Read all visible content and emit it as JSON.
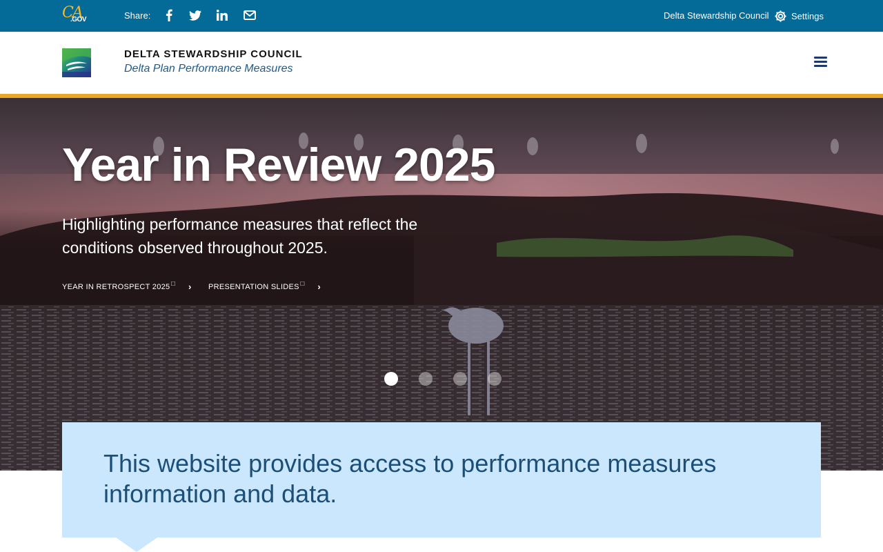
{
  "utility_bar": {
    "logo_script": "CA",
    "logo_gov": ".GOV",
    "share_label": "Share:",
    "share_icons": [
      "facebook-icon",
      "twitter-icon",
      "linkedin-icon",
      "envelope-icon"
    ],
    "council_link": "Delta Stewardship Council",
    "settings_label": "Settings"
  },
  "branding": {
    "title": "DELTA STEWARDSHIP COUNCIL",
    "subtitle": "Delta Plan Performance Measures"
  },
  "hero": {
    "title": "Year in Review 2025",
    "description": "Highlighting performance measures that reflect the conditions observed throughout 2025.",
    "links": [
      {
        "label": "YEAR IN RETROSPECT 2025",
        "ext": "☐",
        "chevron": "›"
      },
      {
        "label": "PRESENTATION SLIDES",
        "ext": "☐",
        "chevron": "›"
      }
    ],
    "slide_count": 4,
    "active_slide": 1
  },
  "callout": {
    "text": "This website provides access to performance measures information and data."
  },
  "colors": {
    "utility_bg": "#046b99",
    "gold_accent": "#e9a729",
    "callout_bg": "#cbe7fd",
    "callout_text": "#1b4f78",
    "brand_subtitle": "#1f5a8a"
  }
}
